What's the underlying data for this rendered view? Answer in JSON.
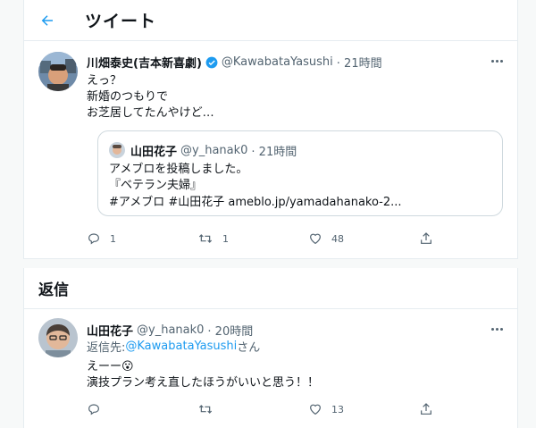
{
  "header": {
    "title": "ツイート"
  },
  "tweet": {
    "name": "川畑泰史(吉本新喜劇)",
    "handle": "@KawabataYasushi",
    "time": "· 21時間",
    "text": "えっ？\n新婚のつもりで\nお芝居してたんやけど…",
    "quote": {
      "name": "山田花子",
      "handle": "@y_hanak0",
      "time": "· 21時間",
      "line1": "アメブロを投稿しました。",
      "line2": "『ベテラン夫婦』",
      "line3": "#アメブロ #山田花子 ameblo.jp/yamadahanako-2..."
    },
    "actions": {
      "replies": "1",
      "retweets": "1",
      "likes": "48"
    }
  },
  "replies_section": {
    "title": "返信"
  },
  "reply": {
    "name": "山田花子",
    "handle": "@y_hanak0",
    "time": "· 20時間",
    "reply_to_prefix": "返信先: ",
    "reply_to_handle": "@KawabataYasushi",
    "reply_to_suffix": "さん",
    "text_line1": "えーー😮",
    "text_line2": "演技プラン考え直したほうがいいと思う！！",
    "actions": {
      "replies": "",
      "retweets": "",
      "likes": "13"
    }
  },
  "colors": {
    "accent": "#1d9bf0",
    "text": "#0f1419",
    "muted": "#536471"
  }
}
